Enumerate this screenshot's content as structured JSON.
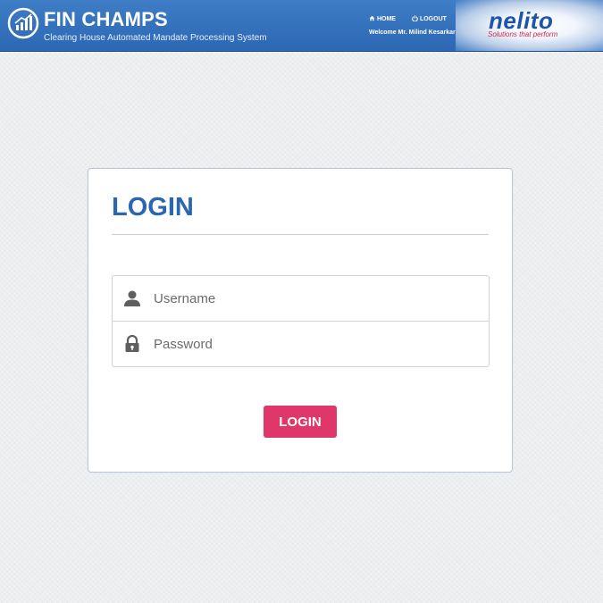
{
  "header": {
    "app_title": "FIN CHAMPS",
    "app_subtitle": "Clearing House Automated Mandate Processing System",
    "home_label": "HOME",
    "logout_label": "LOGOUT",
    "welcome_text": "Welcome Mr. Milind Kesarkar",
    "brand_name": "nelito",
    "brand_tagline": "Solutions that perform"
  },
  "login": {
    "title": "LOGIN",
    "username_placeholder": "Username",
    "password_placeholder": "Password",
    "button_label": "LOGIN"
  },
  "colors": {
    "header_blue": "#2c67b3",
    "title_blue": "#2b67b0",
    "button_pink": "#e0376a",
    "brand_red": "#d0244f"
  },
  "icons": {
    "logo": "bar-chart-circle-icon",
    "home": "home-icon",
    "logout": "power-icon",
    "username": "user-icon",
    "password": "lock-icon"
  }
}
